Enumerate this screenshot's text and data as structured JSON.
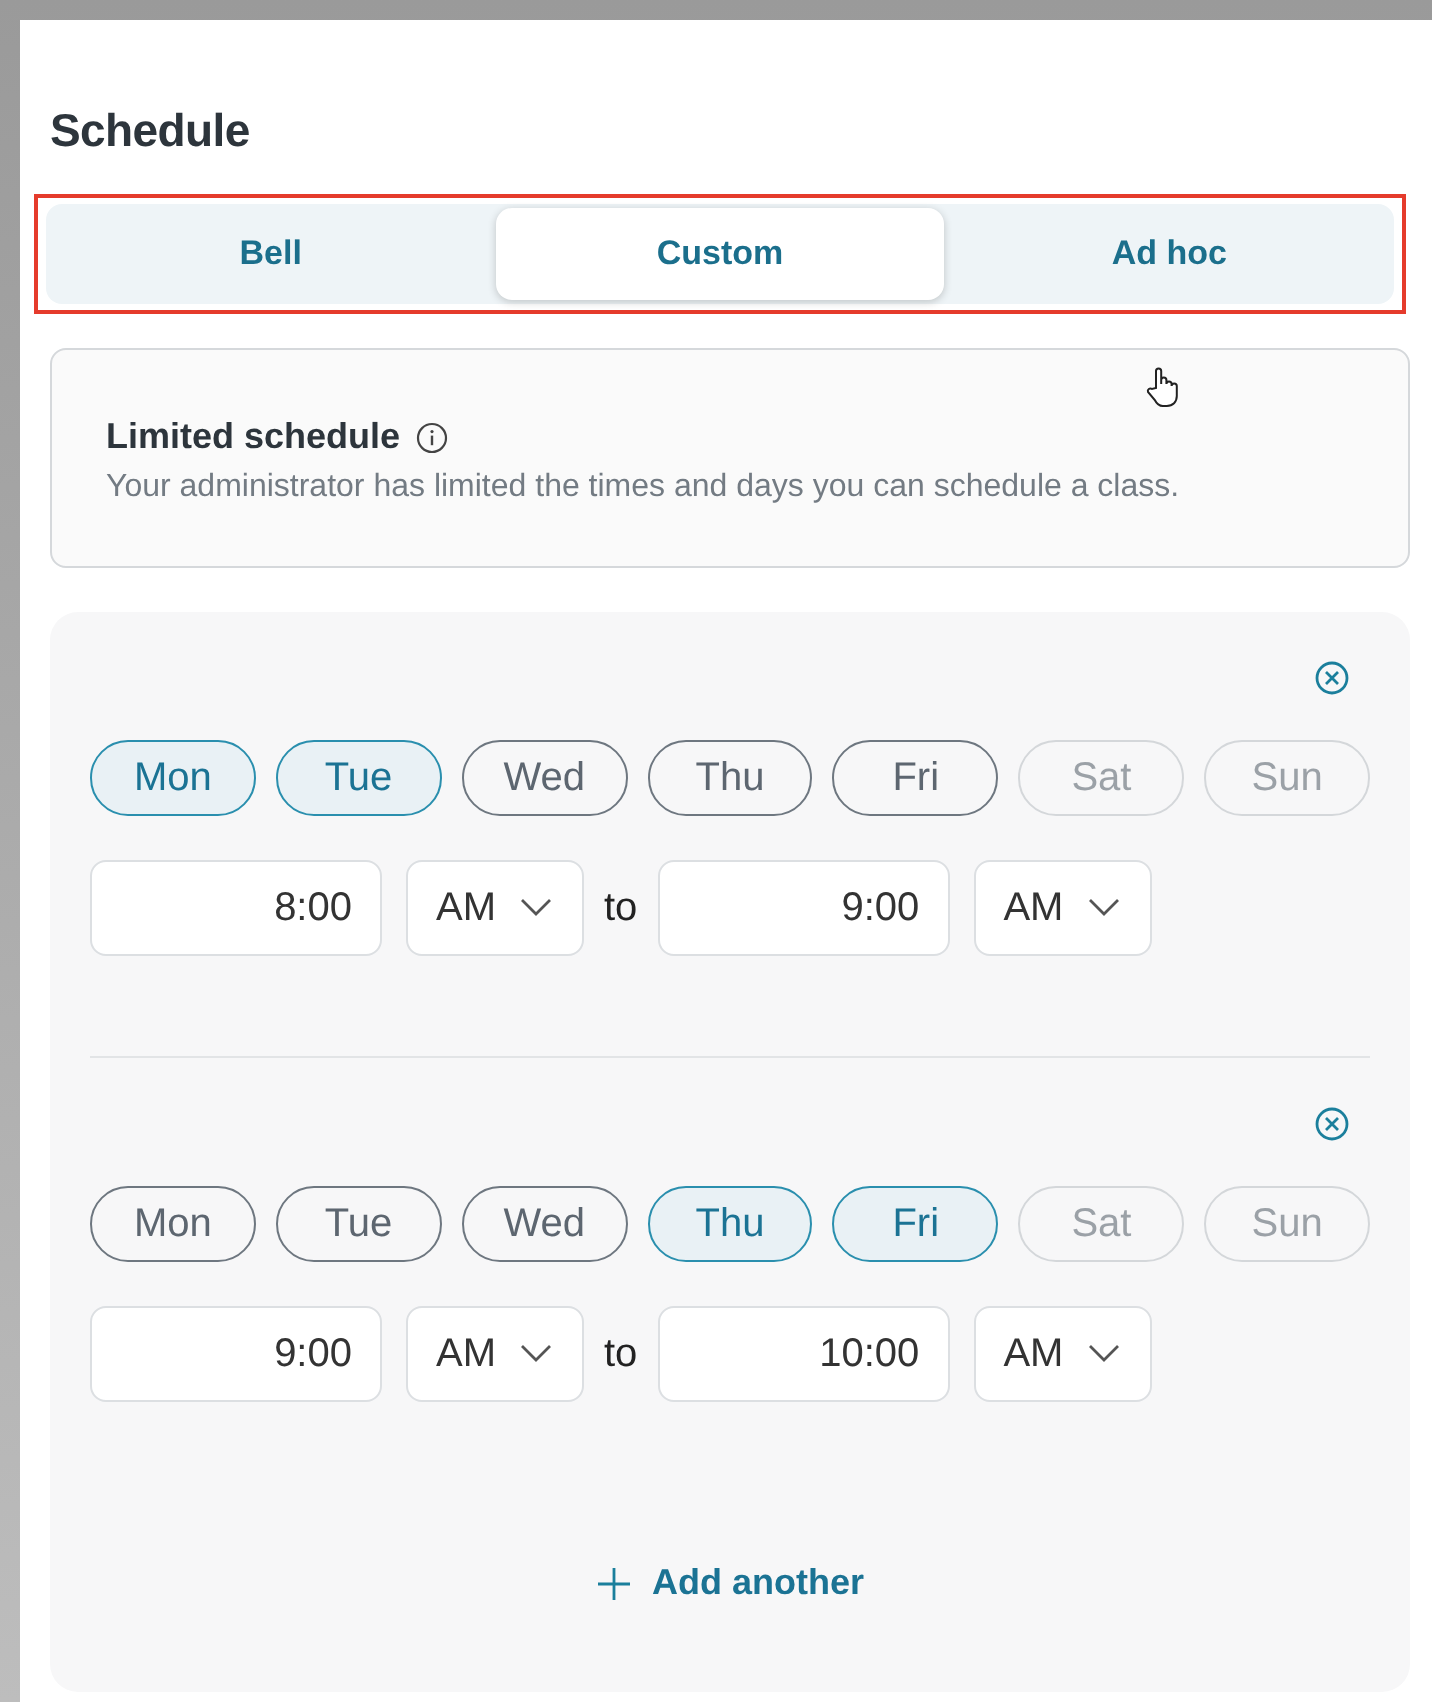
{
  "title": "Schedule",
  "tabs": [
    {
      "label": "Bell",
      "selected": false
    },
    {
      "label": "Custom",
      "selected": true
    },
    {
      "label": "Ad hoc",
      "selected": false
    }
  ],
  "notice": {
    "title": "Limited schedule",
    "text": "Your administrator has limited the times and days you can schedule a class."
  },
  "slots": [
    {
      "days": [
        {
          "label": "Mon",
          "selected": true,
          "disabled": false
        },
        {
          "label": "Tue",
          "selected": true,
          "disabled": false
        },
        {
          "label": "Wed",
          "selected": false,
          "disabled": false
        },
        {
          "label": "Thu",
          "selected": false,
          "disabled": false
        },
        {
          "label": "Fri",
          "selected": false,
          "disabled": false
        },
        {
          "label": "Sat",
          "selected": false,
          "disabled": true
        },
        {
          "label": "Sun",
          "selected": false,
          "disabled": true
        }
      ],
      "start": "8:00",
      "start_period": "AM",
      "separator": "to",
      "end": "9:00",
      "end_period": "AM"
    },
    {
      "days": [
        {
          "label": "Mon",
          "selected": false,
          "disabled": false
        },
        {
          "label": "Tue",
          "selected": false,
          "disabled": false
        },
        {
          "label": "Wed",
          "selected": false,
          "disabled": false
        },
        {
          "label": "Thu",
          "selected": true,
          "disabled": false
        },
        {
          "label": "Fri",
          "selected": true,
          "disabled": false
        },
        {
          "label": "Sat",
          "selected": false,
          "disabled": true
        },
        {
          "label": "Sun",
          "selected": false,
          "disabled": true
        }
      ],
      "start": "9:00",
      "start_period": "AM",
      "separator": "to",
      "end": "10:00",
      "end_period": "AM"
    }
  ],
  "add_button": "Add another"
}
